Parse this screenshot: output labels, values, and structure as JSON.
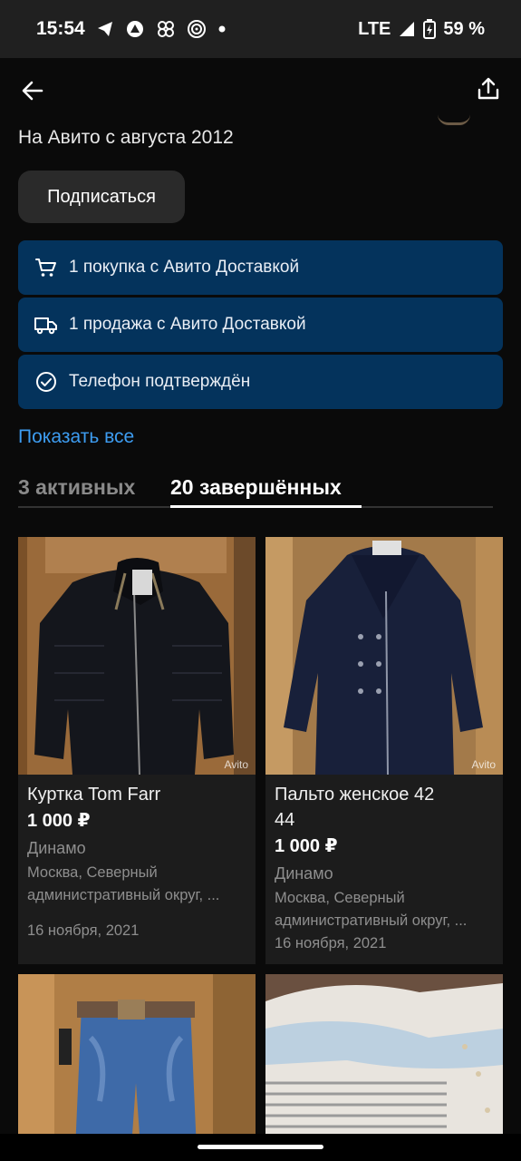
{
  "status_bar": {
    "time": "15:54",
    "network": "LTE",
    "battery": "59 %"
  },
  "profile": {
    "since": "На Авито с августа 2012",
    "subscribe_label": "Подписаться"
  },
  "badges": [
    {
      "icon": "cart-icon",
      "text": "1 покупка с Авито Доставкой"
    },
    {
      "icon": "truck-icon",
      "text": "1 продажа с Авито Доставкой"
    },
    {
      "icon": "check-circle-icon",
      "text": "Телефон подтверждён"
    }
  ],
  "show_all": "Показать все",
  "tabs": {
    "active_count": "3 активных",
    "completed_count": "20 завершённых"
  },
  "listings": [
    {
      "title": "Куртка Tom Farr",
      "price": "1 000 ₽",
      "metro": "Динамо",
      "address_line1": "Москва, Северный",
      "address_line2": "административный округ, ...",
      "date": "16 ноября, 2021",
      "watermark": "Avito"
    },
    {
      "title_line1": "Пальто женское 42",
      "title_line2": "44",
      "price": "1 000 ₽",
      "metro": "Динамо",
      "address_line1": "Москва, Северный",
      "address_line2": "административный округ, ...",
      "date": "16 ноября, 2021",
      "watermark": "Avito"
    },
    {},
    {}
  ],
  "colors": {
    "badge_bg": "#04335c",
    "link": "#3d9cf0",
    "card_bg": "#1c1c1c"
  }
}
